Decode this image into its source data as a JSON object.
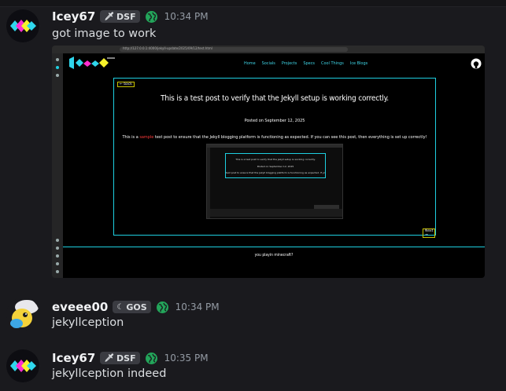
{
  "messages": [
    {
      "username": "Icey67",
      "tag": "DSF",
      "tag_icon": "sword-icon",
      "time": "10:34 PM",
      "text": "got image to work",
      "attachment": {
        "url": "http://127.0.0.1:4000/jekyll-update/2025/09/12/test.html",
        "nav": [
          "Home",
          "Socials",
          "Projects",
          "Specs",
          "Cool Things",
          "Ice Blogs"
        ],
        "back_label": "← back",
        "post_title": "This is a test post to verify that the Jekyll setup is working correctly.",
        "posted_on": "Posted on September 12, 2025",
        "body_before": "This is a ",
        "body_highlight": "sample",
        "body_after": " test post to ensure that the Jekyll blogging platform is functioning as expected. If you can see this post, then everything is set up correctly!",
        "next_label": "Next →",
        "footer_text": "you playin minecraft?",
        "colors": {
          "accent": "#1ecfe0",
          "highlight": "#ff3a3a",
          "button_border": "#c8c200"
        }
      }
    },
    {
      "username": "eveee00",
      "tag": "GOS",
      "tag_icon": "moon-icon",
      "time": "10:34 PM",
      "text": "jekyllception"
    },
    {
      "username": "Icey67",
      "tag": "DSF",
      "tag_icon": "sword-icon",
      "time": "10:35 PM",
      "text": "jekyllception indeed"
    }
  ],
  "colors": {
    "background": "#1a1a1e",
    "username": "#f2f3f5",
    "timestamp": "#949ba4",
    "tag_bg": "#3a3b41",
    "globe": "#23a55a"
  }
}
